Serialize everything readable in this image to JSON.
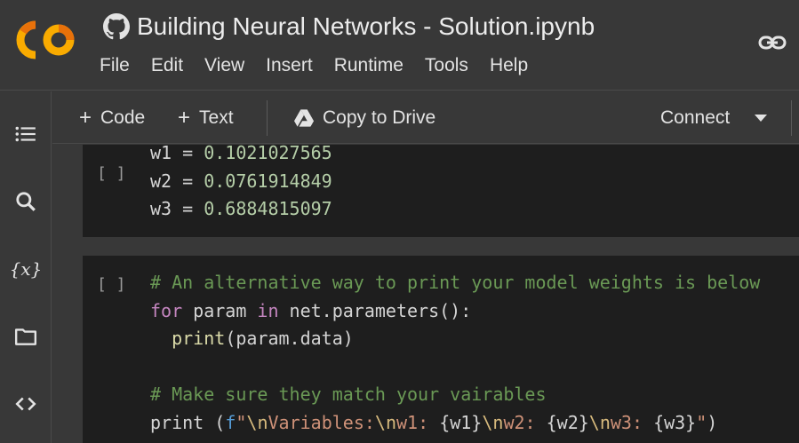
{
  "header": {
    "title": "Building Neural Networks - Solution.ipynb",
    "logo_text": "CO",
    "menu": [
      "File",
      "Edit",
      "View",
      "Insert",
      "Runtime",
      "Tools",
      "Help"
    ]
  },
  "toolbar": {
    "code_label": "Code",
    "text_label": "Text",
    "copy_label": "Copy to Drive",
    "connect_label": "Connect"
  },
  "cells": [
    {
      "run_label": "[ ]",
      "output": [
        {
          "name": "w1",
          "value": "0.1021027565"
        },
        {
          "name": "w2",
          "value": "0.0761914849"
        },
        {
          "name": "w3",
          "value": "0.6884815097"
        }
      ]
    },
    {
      "run_label": "[ ]",
      "lines": {
        "l1_comment": "# An alternative way to print your model weights is below",
        "l2_for": "for",
        "l2_mid": " param ",
        "l2_in": "in",
        "l2_rest": " net.parameters():",
        "l3_indent": "  ",
        "l3_fn": "print",
        "l3_rest": "(param.data)",
        "l5_comment": "# Make sure they match your vairables",
        "l6_fn": "print",
        "l6_open": " (",
        "l6_f": "f",
        "l6_q": "\"",
        "l6_esc1": "\\n",
        "l6_s1": "Variables:",
        "l6_esc2": "\\n",
        "l6_s2": "w1: ",
        "l6_v1": "{w1}",
        "l6_esc3": "\\n",
        "l6_s3": "w2: ",
        "l6_v2": "{w2}",
        "l6_esc4": "\\n",
        "l6_s4": "w3: ",
        "l6_v3": "{w3}",
        "l6_q2": "\"",
        "l6_close": ")"
      }
    }
  ],
  "colors": {
    "background": "#383838",
    "cell_background": "#1e1e1e",
    "logo_orange": "#f9ab00",
    "logo_dark": "#e8710a"
  },
  "icons": [
    "github-icon",
    "link-icon",
    "toc-icon",
    "search-icon",
    "variables-icon",
    "folder-icon",
    "code-snippets-icon",
    "drive-icon",
    "dropdown-icon"
  ]
}
